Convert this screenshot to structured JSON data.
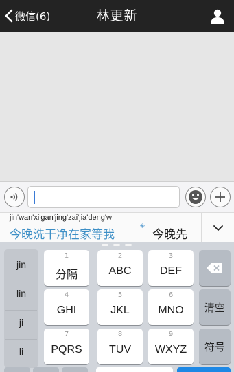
{
  "nav": {
    "back_label": "微信(6)",
    "title": "林更新"
  },
  "icons": {
    "back": "chevron-left-icon",
    "profile": "person-icon",
    "voice": "voice-icon",
    "emoji": "smiley-icon",
    "plus": "plus-icon",
    "expand": "chevron-down-icon",
    "delete": "backspace-icon"
  },
  "input": {
    "value": ""
  },
  "candidates": {
    "pinyin": "jin'wan'xi'gan'jing'zai'jia'deng'w",
    "primary": "今晚洗干净在家等我",
    "secondary": "今晚先"
  },
  "keyboard": {
    "side": [
      "jin",
      "lin",
      "ji",
      "li"
    ],
    "keys": [
      {
        "num": "1",
        "label": "分隔"
      },
      {
        "num": "2",
        "label": "ABC"
      },
      {
        "num": "3",
        "label": "DEF"
      },
      {
        "num": "4",
        "label": "GHI"
      },
      {
        "num": "5",
        "label": "JKL"
      },
      {
        "num": "6",
        "label": "MNO"
      },
      {
        "num": "7",
        "label": "PQRS"
      },
      {
        "num": "8",
        "label": "TUV"
      },
      {
        "num": "9",
        "label": "WXYZ"
      }
    ],
    "clear": "清空",
    "symbols": "符号"
  },
  "colors": {
    "navbar": "#232323",
    "candidate_highlight": "#3d8fc6",
    "keyboard_bg": "#d1d5db"
  }
}
